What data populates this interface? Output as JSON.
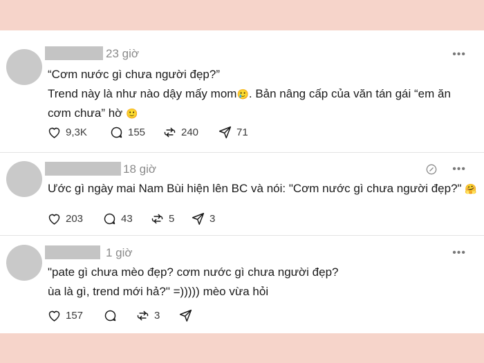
{
  "posts": [
    {
      "time": "23 giờ",
      "lines": [
        "“Cơm nước gì chưa người đẹp?”",
        "Trend này là như nào dậy mấy mom",
        ". Bản nâng cấp của văn tán gái “em ăn",
        "cơm chưa” hờ"
      ],
      "emoji_a": "🥲",
      "emoji_b": "🙂",
      "likes": "9,3K",
      "replies": "155",
      "reposts": "240",
      "shares": "71"
    },
    {
      "time": "18 giờ",
      "line": "Ước gì ngày mai Nam Bùi hiện lên BC và nói: \"Cơm nước gì chưa người đẹp?\"",
      "emoji": "🤗",
      "likes": "203",
      "replies": "43",
      "reposts": "5",
      "shares": "3"
    },
    {
      "time": "1 giờ",
      "lines": [
        "\"pate gì chưa mèo đẹp? cơm nước gì chưa người đẹp?",
        "ùa là gì, trend mới hả?\" =))))) mèo vừa hỏi"
      ],
      "likes": "157",
      "replies": "",
      "reposts": "3",
      "shares": ""
    }
  ],
  "icons": {
    "like": "heart-icon",
    "reply": "comment-icon",
    "repost": "repost-icon",
    "share": "send-icon",
    "more": "more-icon",
    "edited": "edited-icon"
  },
  "more_glyph": "•••"
}
